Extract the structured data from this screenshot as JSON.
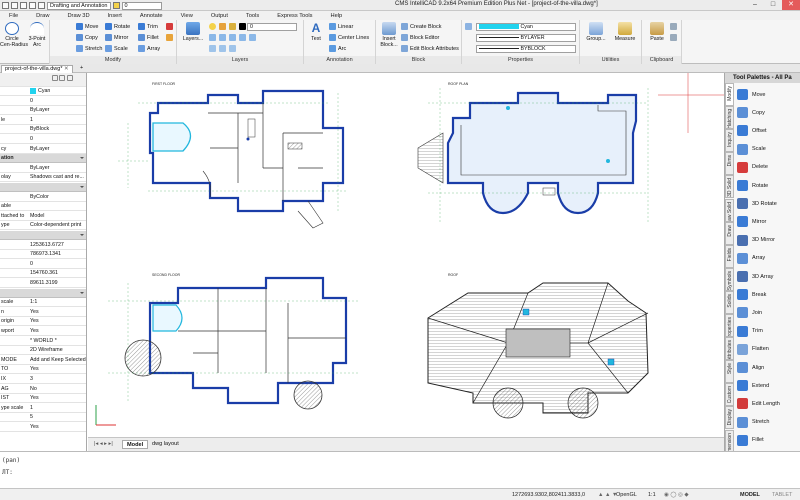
{
  "window": {
    "title": "CMS IntelliCAD 9.2x64 Premium Edition Plus Net - [project-of-the-villa.dwg*]",
    "workspace": "Drafting and Annotation",
    "layer_quick": "0",
    "controls": {
      "minimize": "–",
      "maximize": "□",
      "close": "✕"
    }
  },
  "menubar": [
    "File",
    "Draw",
    "Draw 3D",
    "Insert",
    "Annotate",
    "View",
    "Output",
    "Tools",
    "Express Tools",
    "Help"
  ],
  "ribbon": {
    "draw": {
      "circle_label": "Circle\nCen-Radius",
      "arc_label": "3-Point\nArc"
    },
    "modify": {
      "label": "Modify",
      "items": [
        "Move",
        "Rotate",
        "Trim",
        "Copy",
        "Mirror",
        "Fillet",
        "Stretch",
        "Scale",
        "Array"
      ]
    },
    "layers": {
      "label": "Layers",
      "button": "Layers...",
      "layer_value": "0"
    },
    "annotation": {
      "label": "Annotation",
      "text": "Text",
      "items": [
        "Linear",
        "Center Lines",
        "Arc"
      ]
    },
    "block": {
      "label": "Block",
      "insert": "Insert\nBlock...",
      "items": [
        "Create Block",
        "Block Editor",
        "Edit Block Attributes"
      ]
    },
    "properties": {
      "label": "Properties",
      "color": "Cyan",
      "linetype": "BYLAYER",
      "lineweight": "BYBLOCK"
    },
    "utilities": {
      "label": "Utilities",
      "group": "Group...",
      "measure": "Measure"
    },
    "clipboard": {
      "label": "Clipboard",
      "paste": "Paste"
    }
  },
  "tabs": {
    "active": "project-of-the-villa.dwg*",
    "add": "+"
  },
  "properties_panel": {
    "rows": [
      {
        "key": "",
        "value": "Cyan",
        "section": false,
        "swatch": "#22d3ee"
      },
      {
        "key": "",
        "value": "0",
        "section": false
      },
      {
        "key": "",
        "value": "ByLayer",
        "section": false
      },
      {
        "key": "le",
        "value": "1",
        "section": false
      },
      {
        "key": "",
        "value": "ByBlock",
        "section": false
      },
      {
        "key": "",
        "value": "0",
        "section": false
      },
      {
        "key": "cy",
        "value": "ByLayer",
        "section": false
      },
      {
        "key": "ation",
        "value": "",
        "section": true
      },
      {
        "key": "",
        "value": "ByLayer",
        "section": false
      },
      {
        "key": "olay",
        "value": "Shadows cast and re...",
        "section": false
      },
      {
        "key": "",
        "value": "",
        "section": true
      },
      {
        "key": "",
        "value": "ByColor",
        "section": false
      },
      {
        "key": "able",
        "value": "",
        "section": false
      },
      {
        "key": "ttached to",
        "value": "Model",
        "section": false
      },
      {
        "key": "ype",
        "value": "Color-dependent print",
        "section": false
      },
      {
        "key": "",
        "value": "",
        "section": true
      },
      {
        "key": "",
        "value": "1253613.6727",
        "section": false
      },
      {
        "key": "",
        "value": "786973.1341",
        "section": false
      },
      {
        "key": "",
        "value": "0",
        "section": false
      },
      {
        "key": "",
        "value": "154760.361",
        "section": false
      },
      {
        "key": "",
        "value": "89611.3199",
        "section": false
      },
      {
        "key": "",
        "value": "",
        "section": true
      },
      {
        "key": "scale",
        "value": "1:1",
        "section": false
      },
      {
        "key": "n",
        "value": "Yes",
        "section": false
      },
      {
        "key": "origin",
        "value": "Yes",
        "section": false
      },
      {
        "key": "wport",
        "value": "Yes",
        "section": false
      },
      {
        "key": "",
        "value": "* WORLD *",
        "section": false
      },
      {
        "key": "",
        "value": "2D Wireframe",
        "section": false
      },
      {
        "key": "MODE",
        "value": "Add and Keep Selected",
        "section": false
      },
      {
        "key": "TO",
        "value": "Yes",
        "section": false
      },
      {
        "key": "IX",
        "value": "3",
        "section": false
      },
      {
        "key": "AG",
        "value": "No",
        "section": false
      },
      {
        "key": "IST",
        "value": "Yes",
        "section": false
      },
      {
        "key": "ype scale",
        "value": "1",
        "section": false
      },
      {
        "key": "",
        "value": "5",
        "section": false
      },
      {
        "key": "",
        "value": "Yes",
        "section": false
      }
    ]
  },
  "drawing": {
    "sheets": [
      {
        "title": "FIRST FLOOR"
      },
      {
        "title": "ROOF PLAN"
      },
      {
        "title": "SECOND FLOOR"
      },
      {
        "title": "ROOF"
      }
    ]
  },
  "layout_tabs": [
    "Model",
    "dwg layout"
  ],
  "tool_palettes": {
    "title": "Tool Palettes - All Pa",
    "side_tabs": [
      "Modify",
      "Hatching",
      "Inquiry",
      "Dims",
      "3D Solid",
      "Draw Solid",
      "Draw",
      "Fields",
      "Symbols",
      "Solids",
      "Properties",
      "Attributes",
      "Style",
      "Custom",
      "Display",
      "Dimension"
    ],
    "tools": [
      "Move",
      "Copy",
      "Offset",
      "Scale",
      "Delete",
      "Rotate",
      "3D Rotate",
      "Mirror",
      "3D Mirror",
      "Array",
      "3D Array",
      "Break",
      "Join",
      "Trim",
      "Flatten",
      "Align",
      "Extend",
      "Edit Length",
      "Stretch",
      "Fillet"
    ]
  },
  "command": {
    "history": "(pan)",
    "prompt": "ЛТ:",
    "line3": ""
  },
  "status": {
    "coords": "1272693.9302,802411.3833,0",
    "items": [
      "OpenGL",
      "1:1",
      "MODEL",
      "TABLET"
    ]
  }
}
